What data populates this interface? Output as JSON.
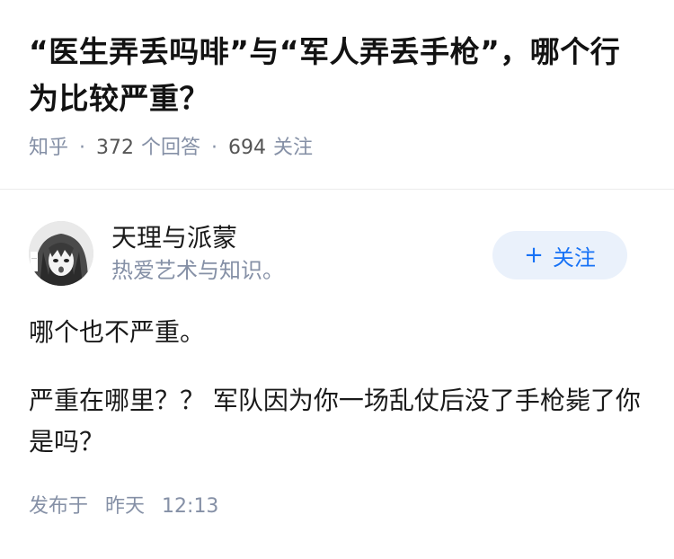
{
  "question": {
    "title": "“医生弄丢吗啡”与“军人弄丢手枪”，哪个行为比较严重？",
    "source": "知乎",
    "answer_count": "372",
    "answer_label": "个回答",
    "follower_count": "694",
    "follower_label": "关注"
  },
  "author": {
    "name": "天理与派蒙",
    "bio": "热爱艺术与知识。",
    "avatar_icon": "anime-avatar-icon",
    "follow_label": "关注"
  },
  "answer": {
    "paragraphs": [
      "哪个也不严重。",
      "严重在哪里？？ 军队因为你一场乱仗后没了手枪毙了你是吗？"
    ],
    "published_label": "发布于",
    "published_day": "昨天",
    "published_time": "12:13"
  },
  "colors": {
    "accent": "#1772f6",
    "meta": "#8590a6"
  }
}
